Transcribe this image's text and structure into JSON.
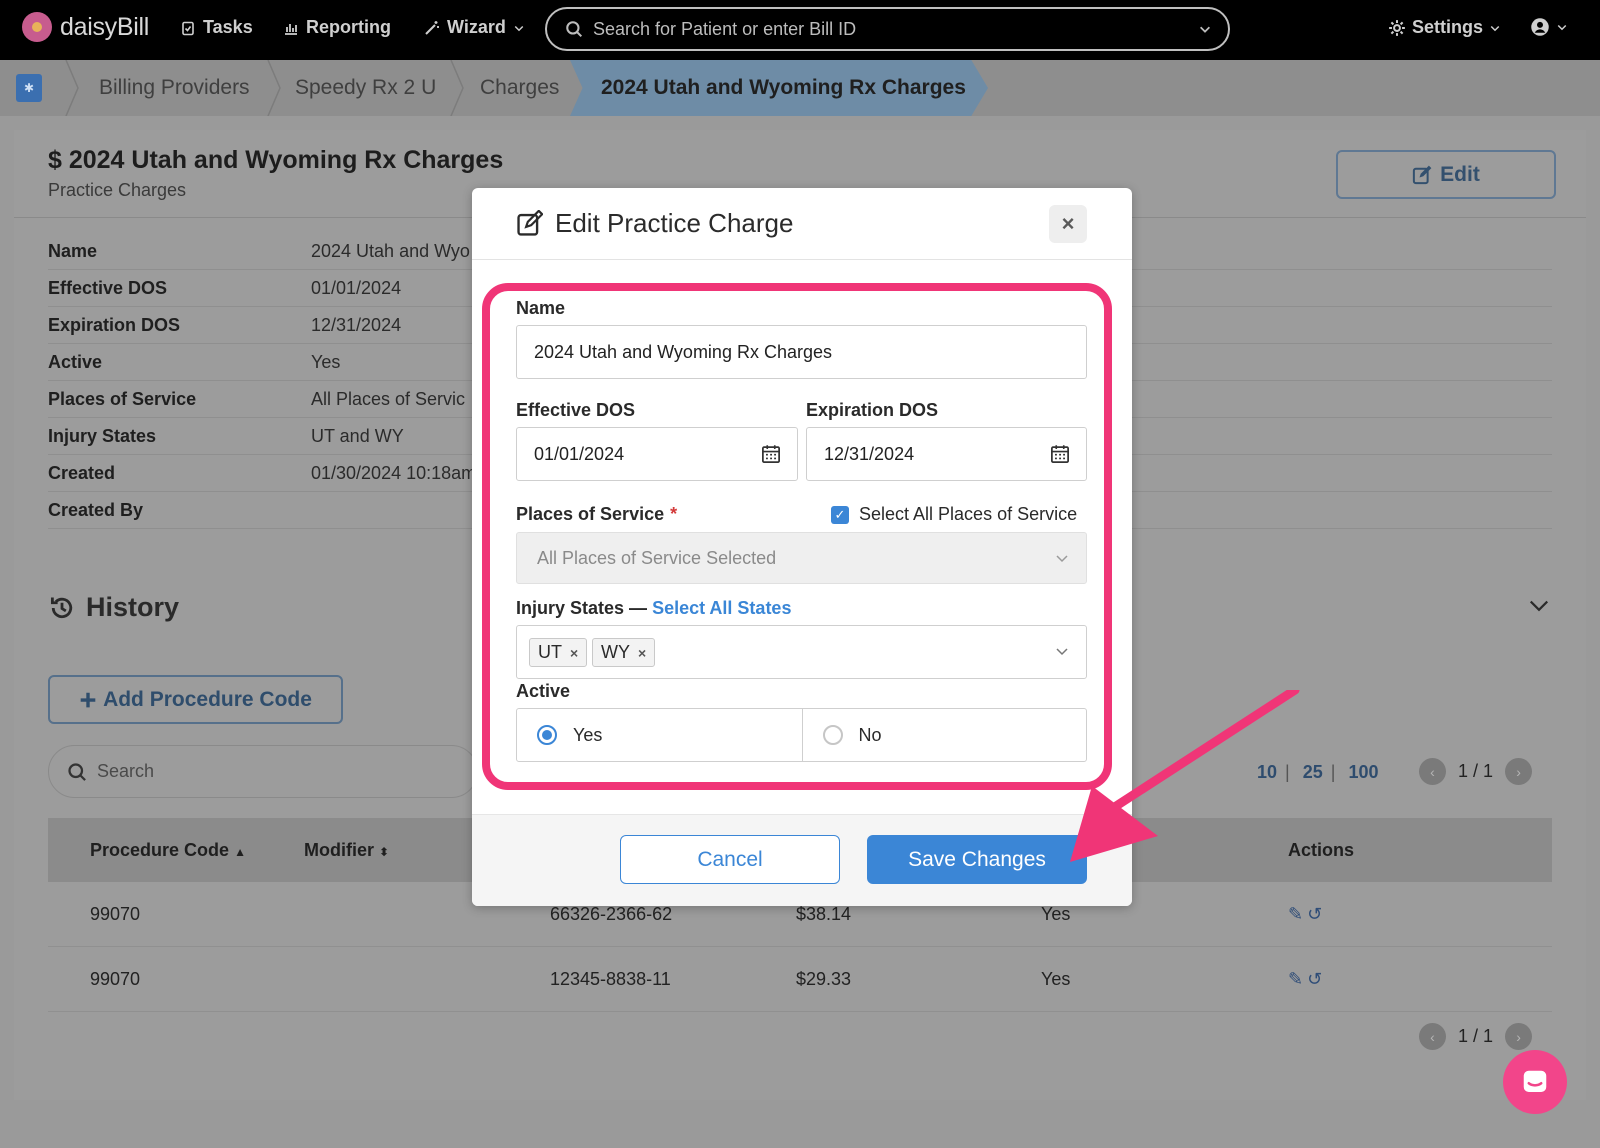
{
  "nav": {
    "logo_text": "daisyBill",
    "tasks": "Tasks",
    "reporting": "Reporting",
    "wizard": "Wizard",
    "search_placeholder": "Search for Patient or enter Bill ID",
    "settings": "Settings"
  },
  "breadcrumb": {
    "items": [
      "Billing Providers",
      "Speedy Rx 2 U",
      "Charges"
    ],
    "active": "2024 Utah and Wyoming Rx Charges"
  },
  "page": {
    "title": "$ 2024 Utah and Wyoming Rx Charges",
    "subtitle": "Practice Charges",
    "edit_label": "Edit",
    "details": [
      {
        "label": "Name",
        "value": "2024 Utah and Wyo"
      },
      {
        "label": "Effective DOS",
        "value": "01/01/2024"
      },
      {
        "label": "Expiration DOS",
        "value": "12/31/2024"
      },
      {
        "label": "Active",
        "value": "Yes"
      },
      {
        "label": "Places of Service",
        "value": "All Places of Servic"
      },
      {
        "label": "Injury States",
        "value": "UT and WY"
      },
      {
        "label": "Created",
        "value": "01/30/2024 10:18am"
      },
      {
        "label": "Created By",
        "value": ""
      }
    ],
    "history_label": "History",
    "add_code_label": "Add Procedure Code",
    "search_placeholder": "Search",
    "page_sizes": [
      "10",
      "25",
      "100"
    ],
    "pager_text": "1 / 1",
    "pager_bottom_text": "1 / 1",
    "table": {
      "headers": [
        "Procedure Code",
        "Modifier",
        "Actions"
      ],
      "rows": [
        {
          "code": "99070",
          "ndc": "66326-2366-62",
          "price": "$38.14",
          "active": "Yes"
        },
        {
          "code": "99070",
          "ndc": "12345-8838-11",
          "price": "$29.33",
          "active": "Yes"
        }
      ]
    }
  },
  "modal": {
    "title": "Edit Practice Charge",
    "close": "×",
    "name_label": "Name",
    "name_value": "2024 Utah and Wyoming Rx Charges",
    "effective_label": "Effective DOS",
    "effective_value": "01/01/2024",
    "expiration_label": "Expiration DOS",
    "expiration_value": "12/31/2024",
    "pos_label": "Places of Service",
    "pos_required": "*",
    "select_all_pos_label": "Select All Places of Service",
    "pos_value": "All Places of Service Selected",
    "injury_label": "Injury States —",
    "select_all_states_label": "Select All States",
    "states": [
      "UT",
      "WY"
    ],
    "active_label": "Active",
    "active_yes": "Yes",
    "active_no": "No",
    "active_selected": "Yes",
    "cancel_label": "Cancel",
    "save_label": "Save Changes"
  },
  "colors": {
    "highlight": "#f03577",
    "primary": "#3b86d6",
    "chat": "#f2458a"
  }
}
